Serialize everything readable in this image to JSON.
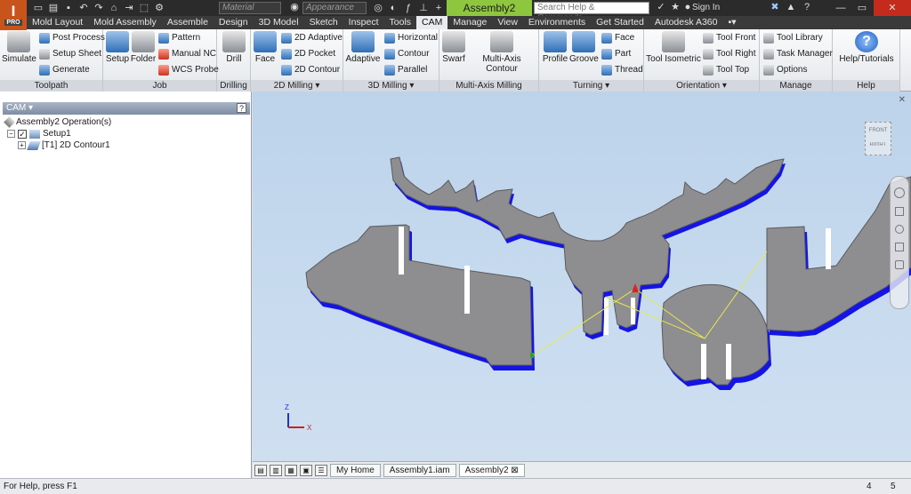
{
  "app": {
    "badge_top": "I",
    "badge_bottom": "PRO"
  },
  "titlebar": {
    "material_placeholder": "Material",
    "appearance_placeholder": "Appearance",
    "doc_title": "Assembly2",
    "search_placeholder": "Search Help & Commands...",
    "sign_in": "Sign In"
  },
  "tabs": [
    "Mold Layout",
    "Mold Assembly",
    "Assemble",
    "Design",
    "3D Model",
    "Sketch",
    "Inspect",
    "Tools",
    "CAM",
    "Manage",
    "View",
    "Environments",
    "Get Started",
    "Autodesk A360"
  ],
  "active_tab": "CAM",
  "ribbon": {
    "toolpath": {
      "title": "Toolpath",
      "simulate": "Simulate",
      "post_process": "Post Process",
      "setup_sheet": "Setup Sheet",
      "generate": "Generate"
    },
    "job": {
      "title": "Job",
      "setup": "Setup",
      "folder": "Folder",
      "pattern": "Pattern",
      "manual_nc": "Manual NC",
      "wcs_probe": "WCS Probe"
    },
    "drilling": {
      "title": "Drilling",
      "drill": "Drill"
    },
    "milling2d": {
      "title": "2D Milling",
      "face": "Face",
      "adaptive": "2D Adaptive",
      "pocket": "2D Pocket",
      "contour": "2D Contour"
    },
    "milling3d": {
      "title": "3D Milling",
      "adaptive": "Adaptive",
      "horizontal": "Horizontal",
      "contour": "Contour",
      "parallel": "Parallel"
    },
    "multiaxis": {
      "title": "Multi-Axis Milling",
      "swarf": "Swarf",
      "multi_axis_contour": "Multi-Axis Contour"
    },
    "turning": {
      "title": "Turning",
      "profile": "Profile",
      "groove": "Groove",
      "face": "Face",
      "part": "Part",
      "thread": "Thread"
    },
    "orientation": {
      "title": "Orientation",
      "tool_isometric": "Tool Isometric",
      "tool_front": "Tool Front",
      "tool_right": "Tool Right",
      "tool_top": "Tool Top"
    },
    "manage": {
      "title": "Manage",
      "tool_library": "Tool Library",
      "task_manager": "Task Manager",
      "options": "Options"
    },
    "help": {
      "title": "Help",
      "help_tutorials": "Help/Tutorials"
    }
  },
  "browser": {
    "title": "CAM",
    "help": "?",
    "root": "Assembly2 Operation(s)",
    "setup": "Setup1",
    "operation": "[T1] 2D Contour1"
  },
  "viewcube": {
    "front": "FRONT",
    "right": "RIGHT"
  },
  "triad": {
    "x": "X",
    "z": "Z"
  },
  "doctabs": [
    "My Home",
    "Assembly1.iam",
    "Assembly2"
  ],
  "active_doctab": "Assembly2",
  "status": {
    "text": "For Help, press F1",
    "n1": "4",
    "n2": "5"
  },
  "colors": {
    "accent": "#8ec63f",
    "brand": "#c8541c",
    "part_face": "#8e8e90",
    "part_edge": "#1414e6",
    "toolpath": "#e8e84a"
  }
}
